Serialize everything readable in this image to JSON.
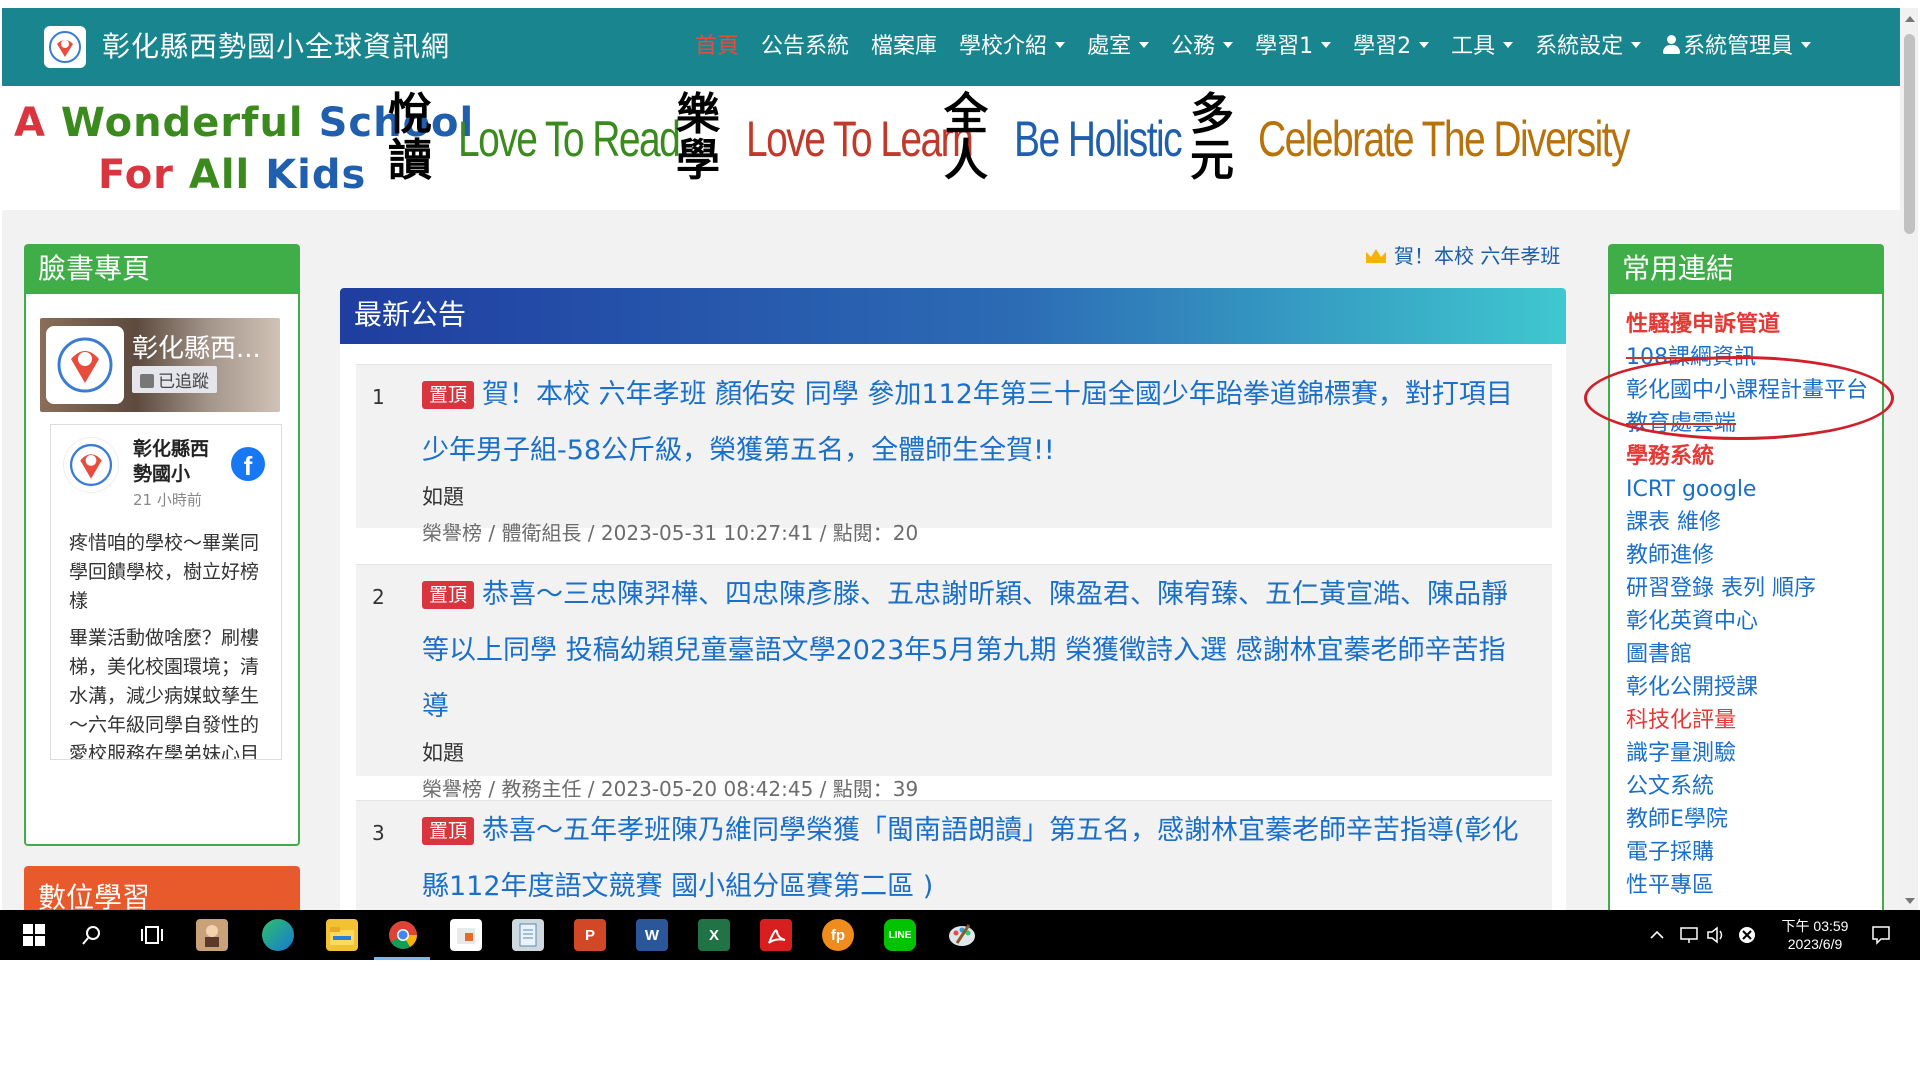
{
  "site": {
    "title": "彰化縣西勢國小全球資訊網",
    "nav": [
      {
        "label": "首頁",
        "active": true,
        "dropdown": false
      },
      {
        "label": "公告系統",
        "active": false,
        "dropdown": false
      },
      {
        "label": "檔案庫",
        "active": false,
        "dropdown": false
      },
      {
        "label": "學校介紹",
        "active": false,
        "dropdown": true
      },
      {
        "label": "處室",
        "active": false,
        "dropdown": true
      },
      {
        "label": "公務",
        "active": false,
        "dropdown": true
      },
      {
        "label": "學習1",
        "active": false,
        "dropdown": true
      },
      {
        "label": "學習2",
        "active": false,
        "dropdown": true
      },
      {
        "label": "工具",
        "active": false,
        "dropdown": true
      },
      {
        "label": "系統設定",
        "active": false,
        "dropdown": true
      },
      {
        "label": "系統管理員",
        "active": false,
        "dropdown": true,
        "user": true
      }
    ]
  },
  "banner": {
    "motto_line1": "A Wonderful School",
    "motto_line2": "For All Kids",
    "items": [
      {
        "cn_top": "悅",
        "cn_bottom": "讀",
        "en": "Love To Read",
        "color": "#3a8a1e"
      },
      {
        "cn_top": "樂",
        "cn_bottom": "學",
        "en": "Love To Learn",
        "color": "#c0392b"
      },
      {
        "cn_top": "全",
        "cn_bottom": "人",
        "en": "Be Holistic",
        "color": "#1f5fae"
      },
      {
        "cn_top": "多",
        "cn_bottom": "元",
        "en": "Celebrate The Diversity",
        "color": "#b8720b"
      }
    ]
  },
  "facebook": {
    "panel_title": "臉書專頁",
    "cover_name": "彰化縣西...",
    "follow_label": "已追蹤",
    "card_name": "彰化縣西勢國小",
    "card_time": "21 小時前",
    "post_text": "疼惜咱的學校～畢業同學回饋學校，樹立好榜樣\n\n畢業活動做啥麼？刷樓梯，美化校園環境；清水溝，減少病媒蚊孳生～六年級同學自發性的愛校服務在學弟妹心目中樹立"
  },
  "digital_panel": {
    "title": "數位學習"
  },
  "marquee": {
    "text": "賀！本校 六年孝班"
  },
  "news": {
    "title": "最新公告",
    "pin_label": "置頂",
    "items": [
      {
        "num": "1",
        "title": "賀！本校 六年孝班 顏佑安 同學 參加112年第三十屆全國少年跆拳道錦標賽，對打項目少年男子組-58公斤級，榮獲第五名，全體師生全賀!!",
        "sub": "如題",
        "meta": "榮譽榜 / 體衛組長 / 2023-05-31 10:27:41 / 點閱：20"
      },
      {
        "num": "2",
        "title": "恭喜～三忠陳羿樺、四忠陳彥滕、五忠謝昕穎、陳盈君、陳宥臻、五仁黃宣澔、陳品靜等以上同學 投稿幼穎兒童臺語文學2023年5月第九期 榮獲徵詩入選 感謝林宜蓁老師辛苦指導",
        "sub": "如題",
        "meta": "榮譽榜 / 教務主任 / 2023-05-20 08:42:45 / 點閱：39"
      },
      {
        "num": "3",
        "title": "恭喜～五年孝班陳乃維同學榮獲「閩南語朗讀」第五名，感謝林宜蓁老師辛苦指導(彰化縣112年度語文競賽 國小組分區賽第二區 )",
        "sub": "",
        "meta": ""
      }
    ]
  },
  "links": {
    "title": "常用連結",
    "items": [
      {
        "label": "性騷擾申訴管道",
        "style": "red"
      },
      {
        "label": "108課綱資訊",
        "style": "strike"
      },
      {
        "label": "彰化國中小課程計畫平台",
        "style": "normal"
      },
      {
        "label": "教育處雲端",
        "style": "strike"
      },
      {
        "label": "學務系統",
        "style": "red"
      },
      {
        "label": "ICRT google",
        "style": "normal"
      },
      {
        "label": "課表 維修",
        "style": "normal"
      },
      {
        "label": "教師進修",
        "style": "normal"
      },
      {
        "label": "研習登錄 表列 順序",
        "style": "normal"
      },
      {
        "label": "彰化英資中心",
        "style": "normal"
      },
      {
        "label": "圖書館",
        "style": "normal"
      },
      {
        "label": "彰化公開授課",
        "style": "normal"
      },
      {
        "label": "科技化評量",
        "style": "normal-red"
      },
      {
        "label": "識字量測驗",
        "style": "normal"
      },
      {
        "label": "公文系統",
        "style": "normal"
      },
      {
        "label": "教師E學院",
        "style": "normal"
      },
      {
        "label": "電子採購",
        "style": "normal"
      },
      {
        "label": "性平專區",
        "style": "normal"
      }
    ]
  },
  "taskbar": {
    "time": "下午 03:59",
    "date": "2023/6/9",
    "apps": [
      "windows-start",
      "search",
      "task-view",
      "contacts",
      "edge",
      "file-explorer",
      "chrome",
      "office",
      "notepad",
      "powerpoint",
      "word",
      "excel",
      "acrobat",
      "foxit",
      "line",
      "paint"
    ],
    "powerpoint_letter": "P",
    "word_letter": "W",
    "excel_letter": "X",
    "foxit_text": "fp",
    "line_text": "LINE"
  }
}
